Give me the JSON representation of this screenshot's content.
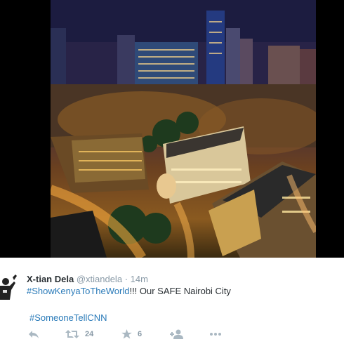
{
  "tweet": {
    "display_name": "X-tian Dela",
    "handle": "@xtiandela",
    "separator": "·",
    "time": "14m",
    "text_hashtag": "#ShowKenyaToTheWorld",
    "text_rest": "!!! Our SAFE Nairobi City",
    "hashtag_2": "#SomeoneTellCNN"
  },
  "actions": {
    "retweets": "24",
    "favorites": "6"
  },
  "colors": {
    "link": "#2b7bb9",
    "muted": "#8899a6",
    "text": "#292f33"
  }
}
